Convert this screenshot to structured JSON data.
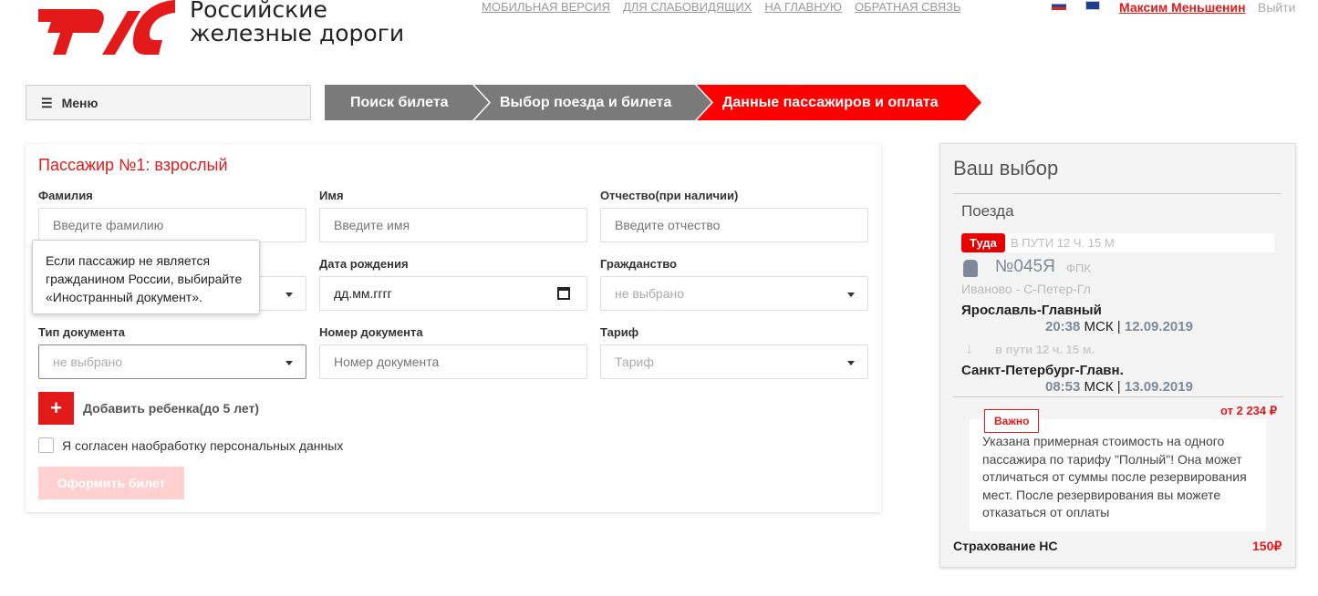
{
  "header": {
    "logo_text": "Российские железные дороги",
    "links": [
      "МОБИЛЬНАЯ ВЕРСИЯ",
      "ДЛЯ СЛАБОВИДЯЩИХ",
      "НА ГЛАВНУЮ",
      "ОБРАТНАЯ СВЯЗЬ"
    ],
    "user": "Максим Меньшенин",
    "logout": "Выйти"
  },
  "menu": {
    "label": "Меню"
  },
  "steps": [
    "Поиск билета",
    "Выбор поезда и билета",
    "Данные пассажиров и оплата"
  ],
  "colors": {
    "accent": "#e21a1a",
    "step_inactive": "#7a7a7a"
  },
  "form": {
    "title": "Пассажир №1: взрослый",
    "fields": [
      {
        "label": "Фамилия",
        "placeholder": "Введите фамилию"
      },
      {
        "label": "Имя",
        "placeholder": "Введите имя"
      },
      {
        "label": "Отчество(при наличии)",
        "placeholder": "Введите отчество"
      },
      {
        "label": "Дата рождения",
        "value": "дд.мм.гггг"
      },
      {
        "label": "Гражданство",
        "value": "не выбрано"
      },
      {
        "label": "Тип документа",
        "value": "не выбрано"
      },
      {
        "label": "Номер документа",
        "placeholder": "Номер документа"
      },
      {
        "label": "Тариф",
        "value": "Тариф"
      }
    ],
    "tooltip": "Если пассажир не является гражданином России, выбирайте «Иностранный документ».",
    "add_child": "Добавить ребенка(до 5 лет)",
    "consent": "Я согласен наобработку персональных данных",
    "submit": "Оформить билет"
  },
  "summary": {
    "title": "Ваш выбор",
    "section": "Поезда",
    "direction": "Туда",
    "travel_time_caps": "В ПУТИ 12 Ч. 15 М",
    "train_no": "№045Я",
    "carrier": "ФПК",
    "route": "Иваново - С-Петер-Гл",
    "from": {
      "station": "Ярославль-Главный",
      "time": "20:38",
      "tz": "МСК",
      "date": "12.09.2019"
    },
    "travel_time": "в пути 12 ч. 15 м.",
    "to": {
      "station": "Санкт-Петербург-Главн.",
      "time": "08:53",
      "tz": "МСК",
      "date": "13.09.2019"
    },
    "price": "от 2 234 ₽",
    "important": "Важно",
    "note": "Указана примерная стоимость на одного пассажира по тарифу \"Полный\"! Она может отличаться от суммы после резервирования мест. После резервирования вы можете отказаться от оплаты",
    "insurance": "Страхование НС",
    "insurance_price": "150₽"
  }
}
